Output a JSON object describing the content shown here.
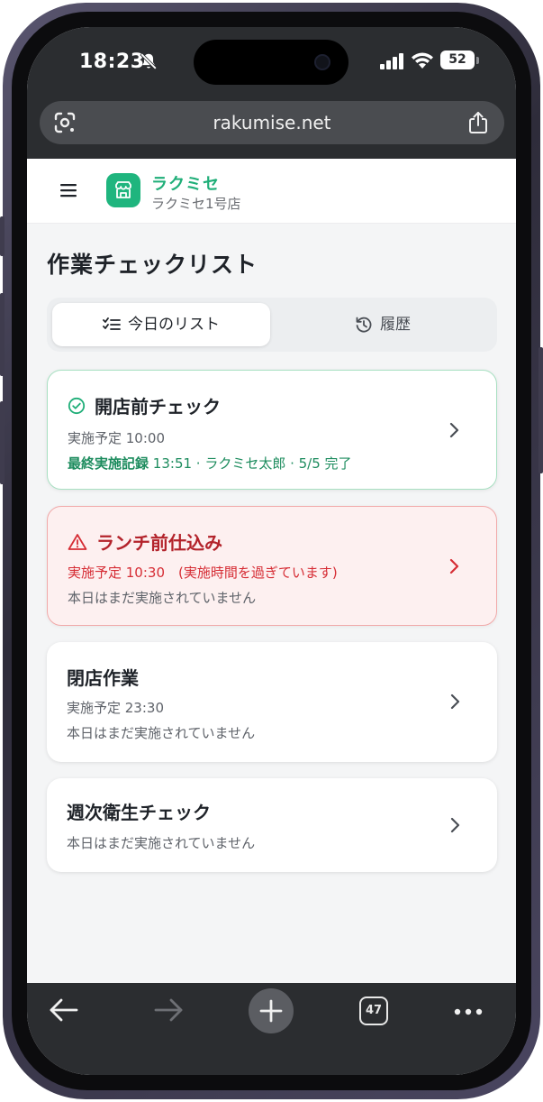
{
  "status_bar": {
    "time": "18:23",
    "battery": "52"
  },
  "browser": {
    "url": "rakumise.net",
    "tab_count": "47"
  },
  "header": {
    "brand": "ラクミセ",
    "store": "ラクミセ1号店"
  },
  "page": {
    "title": "作業チェックリスト"
  },
  "tabs": [
    {
      "label": "今日のリスト",
      "active": true
    },
    {
      "label": "履歴",
      "active": false
    }
  ],
  "tasks": [
    {
      "title": "開店前チェック",
      "status": "completed",
      "schedule": "実施予定 10:00",
      "record_label": "最終実施記録",
      "record_detail": "13:51 · ラクミセ太郎 · 5/5 完了"
    },
    {
      "title": "ランチ前仕込み",
      "status": "overdue",
      "schedule": "実施予定 10:30　(実施時間を過ぎています)",
      "note": "本日はまだ実施されていません"
    },
    {
      "title": "閉店作業",
      "status": "pending",
      "schedule": "実施予定 23:30",
      "note": "本日はまだ実施されていません"
    },
    {
      "title": "週次衛生チェック",
      "status": "pending",
      "note": "本日はまだ実施されていません"
    }
  ],
  "colors": {
    "brand_green": "#1fb57e",
    "warning_red": "#b3232b",
    "chrome_dark": "#2b2d30"
  }
}
